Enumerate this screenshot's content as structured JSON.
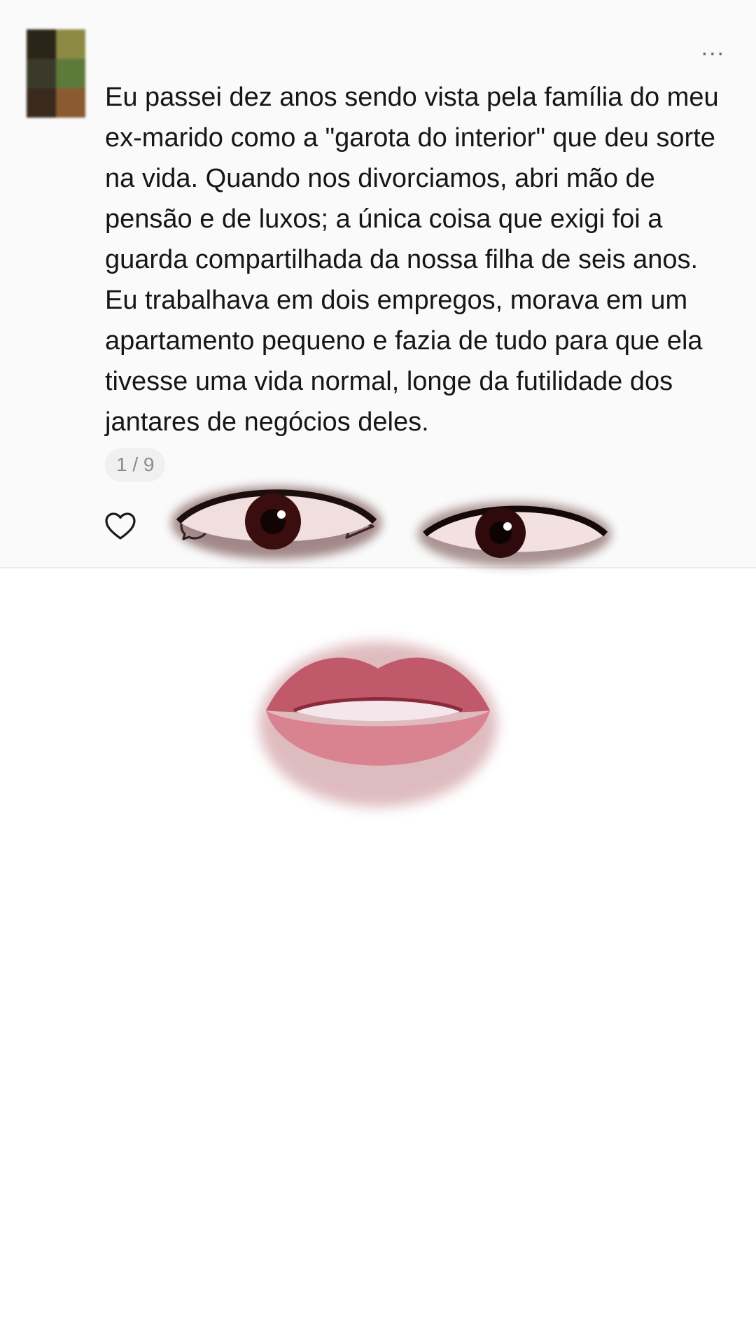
{
  "post": {
    "text": "Eu passei dez anos sendo vista pela família do meu ex-marido como a \"garota do interior\" que deu sorte na vida. Quando nos divorciamos, abri mão de pensão e de luxos; a única coisa que exigi foi a guarda compartilhada da nossa filha de seis anos. Eu trabalhava em dois empregos, morava em um apartamento pequeno e fazia de tudo para que ela tivesse uma vida normal, longe da futilidade dos jantares de negócios deles.",
    "image_counter": "1 / 9",
    "more_label": "...",
    "actions": {
      "like_icon": "heart-outline-icon",
      "comment_icon": "comment-icon",
      "share_icon": "share-icon"
    }
  },
  "overlay": {
    "features": [
      "eye",
      "eye",
      "lips"
    ]
  },
  "colors": {
    "background": "#ffffff",
    "post_background": "#fafafa",
    "text": "#161616",
    "muted": "#8a8a8a",
    "iris": "#3a0d0f",
    "lips": "#c8606e"
  }
}
